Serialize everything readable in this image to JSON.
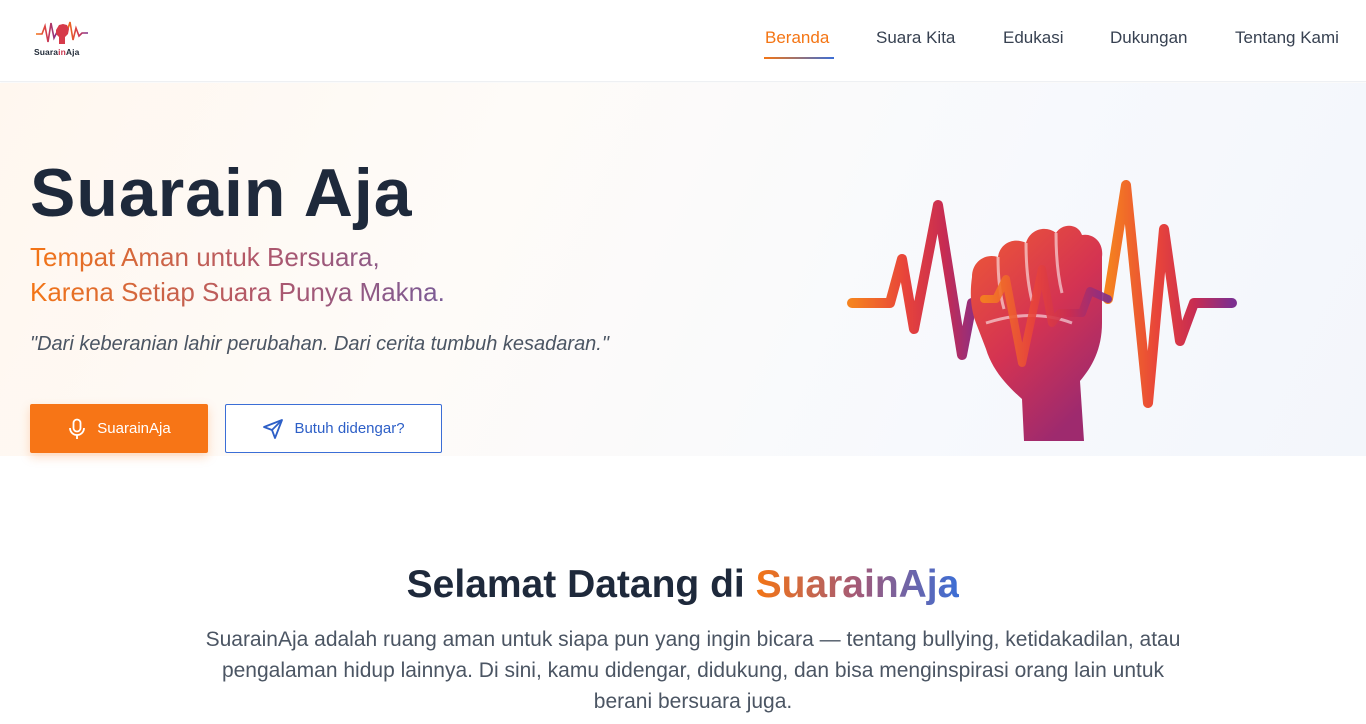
{
  "nav": {
    "logo_text_start": "Suara",
    "logo_text_mid": "in",
    "logo_text_end": "Aja",
    "items": [
      {
        "label": "Beranda",
        "active": true
      },
      {
        "label": "Suara Kita",
        "active": false
      },
      {
        "label": "Edukasi",
        "active": false
      },
      {
        "label": "Dukungan",
        "active": false
      },
      {
        "label": "Tentang Kami",
        "active": false
      }
    ]
  },
  "hero": {
    "title": "Suarain Aja",
    "subtitle_line1": "Tempat Aman untuk Bersuara,",
    "subtitle_line2": "Karena Setiap Suara Punya Makna.",
    "quote": "\"Dari keberanian lahir perubahan. Dari cerita tumbuh kesadaran.\"",
    "primary_button": {
      "label": "SuarainAja",
      "icon": "microphone-icon"
    },
    "secondary_button": {
      "label": "Butuh didengar?",
      "icon": "send-icon"
    }
  },
  "welcome": {
    "title_prefix": "Selamat Datang di ",
    "title_brand": "SuarainAja",
    "body": "SuarainAja adalah ruang aman untuk siapa pun yang ingin bicara — tentang bullying, ketidakadilan, atau pengalaman hidup lainnya. Di sini, kamu didengar, didukung, dan bisa menginspirasi orang lain untuk berani bersuara juga."
  },
  "colors": {
    "accent_orange": "#f77516",
    "accent_blue": "#3b6ed6",
    "accent_magenta": "#c8324b",
    "accent_purple": "#7a2f8e",
    "heading": "#1e293b"
  }
}
